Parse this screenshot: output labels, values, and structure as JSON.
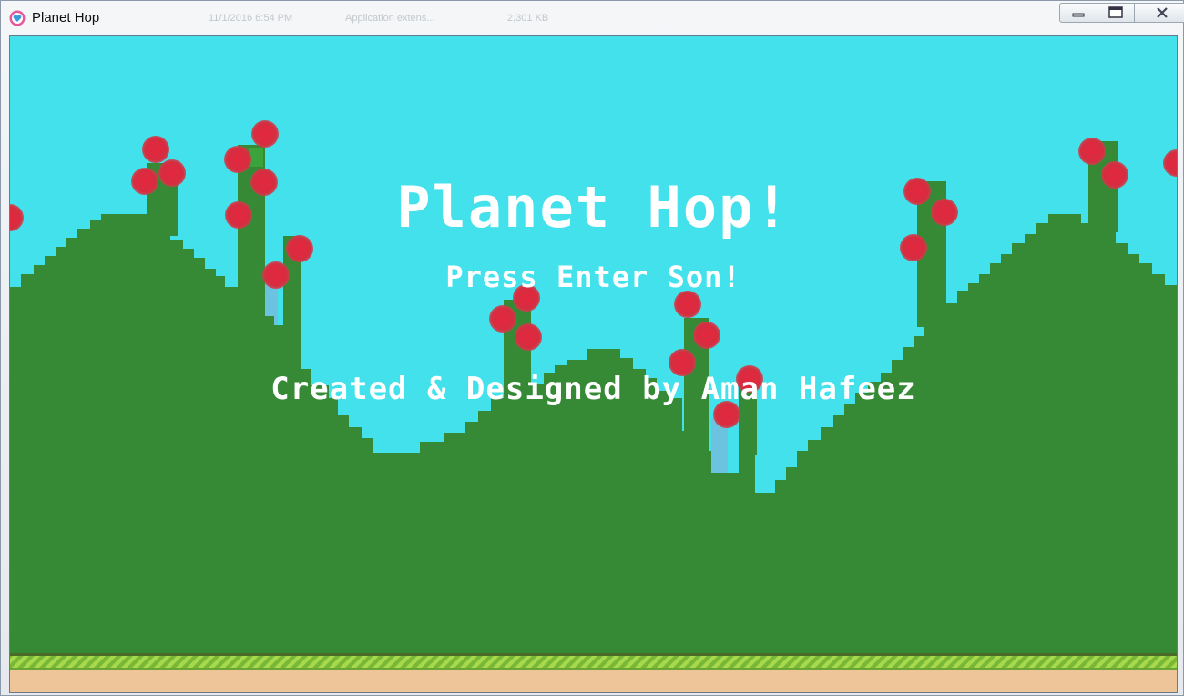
{
  "window": {
    "title": "Planet Hop",
    "background_details": [
      "11/1/2016 6:54 PM",
      "Application extens...",
      "2,301 KB"
    ]
  },
  "game": {
    "title": "Planet Hop!",
    "prompt": "Press Enter Son!",
    "credits": "Created & Designed by Aman Hafeez"
  },
  "colors": {
    "sky": "#43e1ec",
    "hills": "#368a36",
    "fruit": "#dd2b3f",
    "ground": "#edc599",
    "grass_stripe": "#9ed04a",
    "text": "#ffffff"
  },
  "icons": [
    "heart-app-icon",
    "minimize-icon",
    "maximize-icon",
    "close-icon"
  ]
}
